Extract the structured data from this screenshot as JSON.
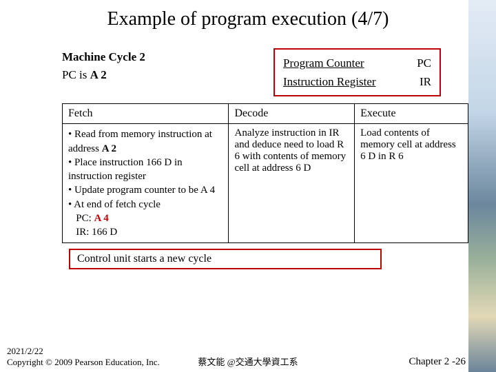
{
  "title": "Example of program execution (4/7)",
  "machine_cycle_label": "Machine Cycle 2",
  "pc_line_prefix": "PC is ",
  "pc_line_value": "A 2",
  "reg_box": {
    "pc_label": "Program Counter",
    "pc_short": "PC",
    "ir_label": "Instruction Register",
    "ir_short": "IR"
  },
  "table": {
    "headers": {
      "fetch": "Fetch",
      "decode": "Decode",
      "execute": "Execute"
    },
    "fetch": {
      "b1a": "• Read  from memory instruction at address ",
      "b1b": "A 2",
      "b2": "• Place instruction 166 D in instruction register",
      "b3": "• Update program counter to be A 4",
      "b4": "• At end of fetch cycle",
      "pc_lbl": "   PC: ",
      "pc_val": "A 4",
      "ir_lbl": "   IR: 166 D"
    },
    "decode": "Analyze instruction in IR and deduce need to load R 6 with contents of memory cell at address 6 D",
    "execute": "Load contents of memory cell at address 6 D in R 6"
  },
  "control_box": "Control unit starts a new cycle",
  "footer": {
    "date": "2021/2/22",
    "copyright": "Copyright © 2009 Pearson Education, Inc.",
    "center": "蔡文能 @交通大學資工系",
    "right": "Chapter 2 -26"
  }
}
